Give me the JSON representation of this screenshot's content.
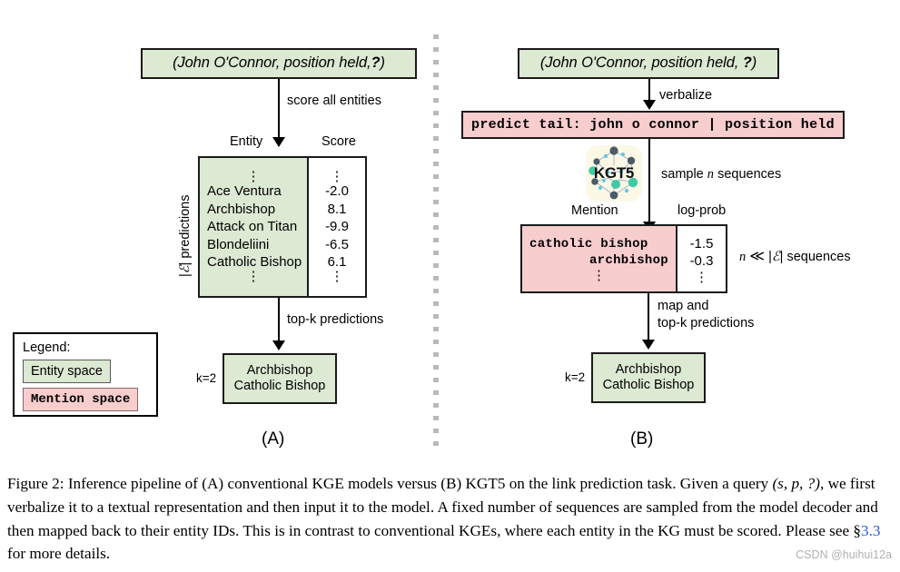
{
  "figure": {
    "panel_a": {
      "label": "(A)",
      "query": "(John O'Connor, position held,",
      "query_q": "?",
      "query_end": ")",
      "arrow_label": "score all entities",
      "table": {
        "headers": [
          "Entity",
          "Score"
        ],
        "side_label_prefix": "|",
        "side_label_cal": "ℰ",
        "side_label_suffix": "| predictions",
        "vdots": "⋮",
        "rows": [
          {
            "entity": "Ace Ventura",
            "score": "-2.0"
          },
          {
            "entity": "Archbishop",
            "score": "8.1"
          },
          {
            "entity": "Attack on Titan",
            "score": "-9.9"
          },
          {
            "entity": "Blondeliini",
            "score": "-6.5"
          },
          {
            "entity": "Catholic Bishop",
            "score": "6.1"
          }
        ]
      },
      "result_arrow_label": "top-k predictions",
      "result_k": "k=2",
      "result_lines": [
        "Archbishop",
        "Catholic Bishop"
      ]
    },
    "panel_b": {
      "label": "(B)",
      "query": "(John O'Connor, position held,",
      "query_q": "?",
      "query_end": ")",
      "verbalize_label": "verbalize",
      "verbalized_text": "predict tail: john o connor | position held",
      "model_name": "KGT5",
      "sample_label_pre": "sample",
      "sample_label_n": "n",
      "sample_label_post": "sequences",
      "table": {
        "headers": [
          "Mention",
          "log-prob"
        ],
        "vdots": "⋮",
        "rows": [
          {
            "mention": "catholic bishop",
            "logprob": "-1.5"
          },
          {
            "mention": "archbishop",
            "logprob": "-0.3"
          }
        ]
      },
      "side_note_n": "n",
      "side_note_ll": "≪",
      "side_note_cal": "ℰ",
      "side_note_text": "sequences",
      "result_arrow_line1": "map and",
      "result_arrow_line2": "top-k  predictions",
      "result_k": "k=2",
      "result_lines": [
        "Archbishop",
        "Catholic Bishop"
      ]
    },
    "legend": {
      "title": "Legend:",
      "entity_space": "Entity space",
      "mention_space": "Mention space"
    },
    "colors": {
      "entity_green": "#dce9d3",
      "mention_pink": "#f8cdcd",
      "link_blue": "#2a5bd7",
      "watermark_gray": "#b0b0b0"
    }
  },
  "caption": {
    "part1": "Figure 2: Inference pipeline of (A) conventional KGE models versus (B) KGT5 on the link prediction task. Given a query ",
    "query_math": "(s, p, ?)",
    "part2": ", we first verbalize it to a textual representation and then input it to the model. A fixed number of sequences are sampled from the model decoder and then mapped back to their entity IDs. This is in contrast to conventional KGEs, where each entity in the KG must be scored. Please see §",
    "link": "3.3",
    "part3": " for more details."
  },
  "watermark": "CSDN @huihui12a"
}
